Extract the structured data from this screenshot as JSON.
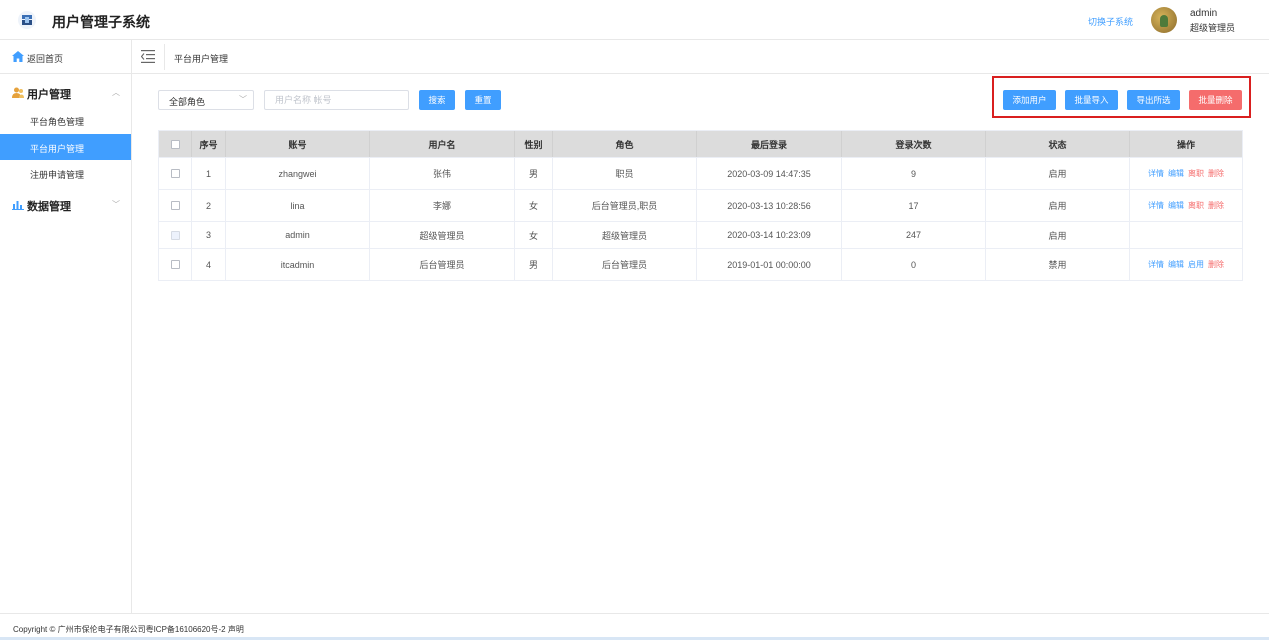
{
  "header": {
    "title": "用户管理子系统",
    "switch_label": "切换子系统",
    "user_name": "admin",
    "user_role": "超级管理员"
  },
  "sidebar": {
    "home_label": "返回首页",
    "groups": [
      {
        "label": "用户管理",
        "expanded": true,
        "items": [
          {
            "label": "平台角色管理",
            "active": false
          },
          {
            "label": "平台用户管理",
            "active": true
          },
          {
            "label": "注册申请管理",
            "active": false
          }
        ]
      },
      {
        "label": "数据管理",
        "expanded": false,
        "items": []
      }
    ]
  },
  "breadcrumb": {
    "current": "平台用户管理"
  },
  "filters": {
    "role_select_value": "全部角色",
    "search_placeholder": "用户名称 帐号",
    "search_button": "搜索",
    "reset_button": "重置"
  },
  "actions": {
    "add_user": "添加用户",
    "batch_import": "批量导入",
    "export_selected": "导出所选",
    "batch_delete": "批量删除"
  },
  "table": {
    "columns": [
      "序号",
      "账号",
      "用户名",
      "性别",
      "角色",
      "最后登录",
      "登录次数",
      "状态",
      "操作"
    ],
    "rows": [
      {
        "index": "1",
        "account": "zhangwei",
        "username": "张伟",
        "gender": "男",
        "role": "职员",
        "last_login": "2020-03-09 14:47:35",
        "login_count": "9",
        "status": "启用",
        "actions": [
          "详情",
          "编辑",
          "离职",
          "删除"
        ],
        "checkbox_disabled": false
      },
      {
        "index": "2",
        "account": "lina",
        "username": "李娜",
        "gender": "女",
        "role": "后台管理员,职员",
        "last_login": "2020-03-13 10:28:56",
        "login_count": "17",
        "status": "启用",
        "actions": [
          "详情",
          "编辑",
          "离职",
          "删除"
        ],
        "checkbox_disabled": false
      },
      {
        "index": "3",
        "account": "admin",
        "username": "超级管理员",
        "gender": "女",
        "role": "超级管理员",
        "last_login": "2020-03-14 10:23:09",
        "login_count": "247",
        "status": "启用",
        "actions": [],
        "checkbox_disabled": true
      },
      {
        "index": "4",
        "account": "itcadmin",
        "username": "后台管理员",
        "gender": "男",
        "role": "后台管理员",
        "last_login": "2019-01-01 00:00:00",
        "login_count": "0",
        "status": "禁用",
        "actions": [
          "详情",
          "编辑",
          "启用",
          "删除"
        ],
        "checkbox_disabled": false
      }
    ]
  },
  "footer": {
    "text": "Copyright © 广州市保伦电子有限公司粤ICP备16106620号-2 声明"
  },
  "colors": {
    "primary": "#409eff",
    "danger": "#f56c6c",
    "highlight_border": "#d91f1f",
    "header_bg": "#dcdcdc"
  },
  "icons": {
    "logo": "app-logo-icon",
    "home": "home-icon",
    "user_group": "users-icon",
    "data_group": "bar-chart-icon",
    "collapse": "menu-fold-icon"
  }
}
